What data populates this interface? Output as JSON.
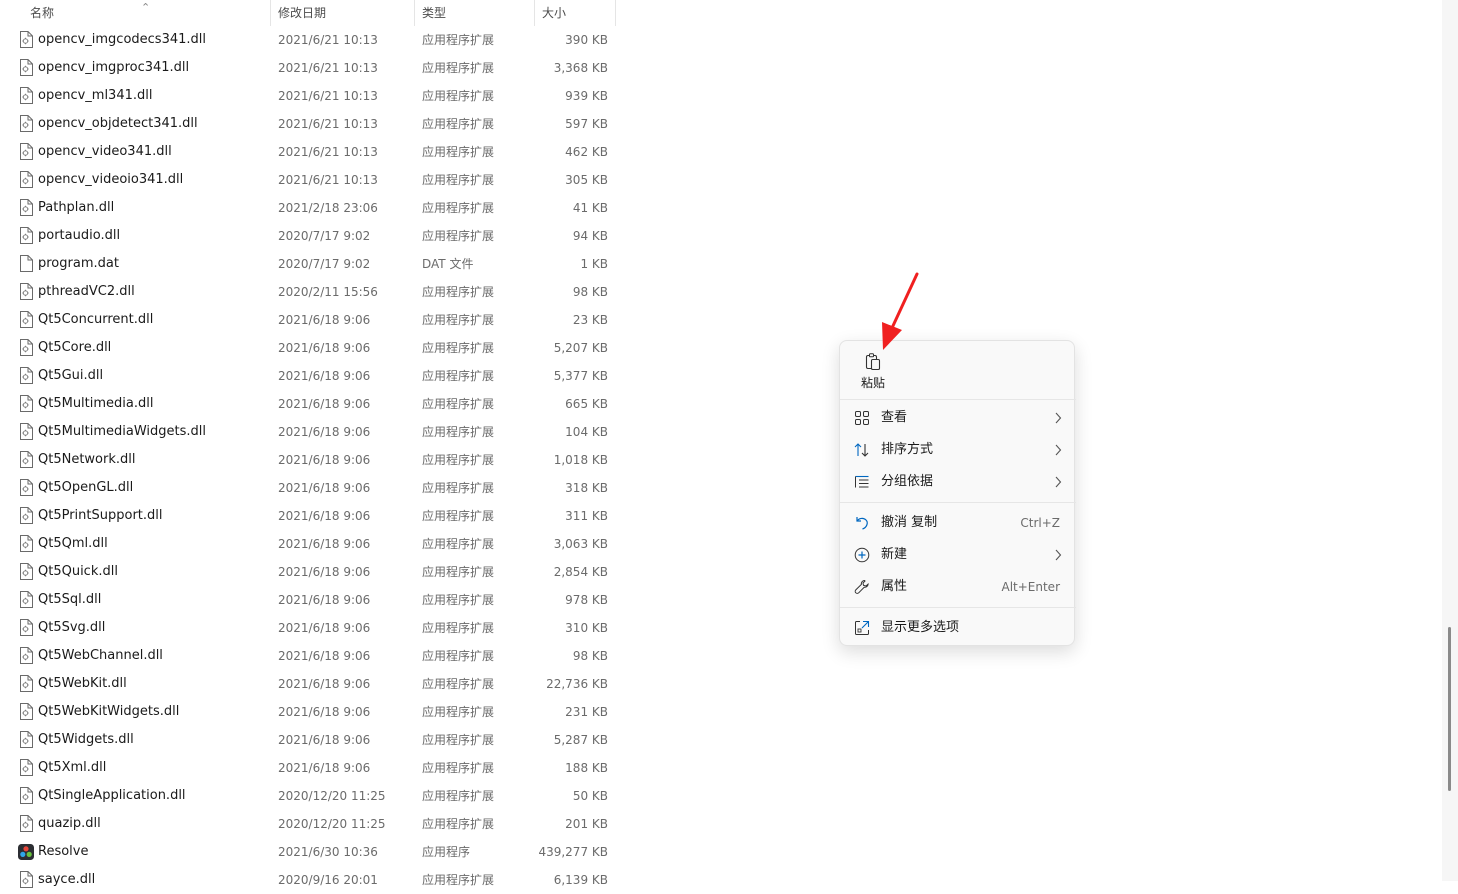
{
  "columns": {
    "name": "名称",
    "date": "修改日期",
    "type": "类型",
    "size": "大小"
  },
  "files": [
    {
      "name": "opencv_imgcodecs341.dll",
      "date": "2021/6/21 10:13",
      "type": "应用程序扩展",
      "size": "390 KB",
      "icon": "dll-file-icon"
    },
    {
      "name": "opencv_imgproc341.dll",
      "date": "2021/6/21 10:13",
      "type": "应用程序扩展",
      "size": "3,368 KB",
      "icon": "dll-file-icon"
    },
    {
      "name": "opencv_ml341.dll",
      "date": "2021/6/21 10:13",
      "type": "应用程序扩展",
      "size": "939 KB",
      "icon": "dll-file-icon"
    },
    {
      "name": "opencv_objdetect341.dll",
      "date": "2021/6/21 10:13",
      "type": "应用程序扩展",
      "size": "597 KB",
      "icon": "dll-file-icon"
    },
    {
      "name": "opencv_video341.dll",
      "date": "2021/6/21 10:13",
      "type": "应用程序扩展",
      "size": "462 KB",
      "icon": "dll-file-icon"
    },
    {
      "name": "opencv_videoio341.dll",
      "date": "2021/6/21 10:13",
      "type": "应用程序扩展",
      "size": "305 KB",
      "icon": "dll-file-icon"
    },
    {
      "name": "Pathplan.dll",
      "date": "2021/2/18 23:06",
      "type": "应用程序扩展",
      "size": "41 KB",
      "icon": "dll-file-icon"
    },
    {
      "name": "portaudio.dll",
      "date": "2020/7/17 9:02",
      "type": "应用程序扩展",
      "size": "94 KB",
      "icon": "dll-file-icon"
    },
    {
      "name": "program.dat",
      "date": "2020/7/17 9:02",
      "type": "DAT 文件",
      "size": "1 KB",
      "icon": "blank-file-icon"
    },
    {
      "name": "pthreadVC2.dll",
      "date": "2020/2/11 15:56",
      "type": "应用程序扩展",
      "size": "98 KB",
      "icon": "dll-file-icon"
    },
    {
      "name": "Qt5Concurrent.dll",
      "date": "2021/6/18 9:06",
      "type": "应用程序扩展",
      "size": "23 KB",
      "icon": "dll-file-icon"
    },
    {
      "name": "Qt5Core.dll",
      "date": "2021/6/18 9:06",
      "type": "应用程序扩展",
      "size": "5,207 KB",
      "icon": "dll-file-icon"
    },
    {
      "name": "Qt5Gui.dll",
      "date": "2021/6/18 9:06",
      "type": "应用程序扩展",
      "size": "5,377 KB",
      "icon": "dll-file-icon"
    },
    {
      "name": "Qt5Multimedia.dll",
      "date": "2021/6/18 9:06",
      "type": "应用程序扩展",
      "size": "665 KB",
      "icon": "dll-file-icon"
    },
    {
      "name": "Qt5MultimediaWidgets.dll",
      "date": "2021/6/18 9:06",
      "type": "应用程序扩展",
      "size": "104 KB",
      "icon": "dll-file-icon"
    },
    {
      "name": "Qt5Network.dll",
      "date": "2021/6/18 9:06",
      "type": "应用程序扩展",
      "size": "1,018 KB",
      "icon": "dll-file-icon"
    },
    {
      "name": "Qt5OpenGL.dll",
      "date": "2021/6/18 9:06",
      "type": "应用程序扩展",
      "size": "318 KB",
      "icon": "dll-file-icon"
    },
    {
      "name": "Qt5PrintSupport.dll",
      "date": "2021/6/18 9:06",
      "type": "应用程序扩展",
      "size": "311 KB",
      "icon": "dll-file-icon"
    },
    {
      "name": "Qt5Qml.dll",
      "date": "2021/6/18 9:06",
      "type": "应用程序扩展",
      "size": "3,063 KB",
      "icon": "dll-file-icon"
    },
    {
      "name": "Qt5Quick.dll",
      "date": "2021/6/18 9:06",
      "type": "应用程序扩展",
      "size": "2,854 KB",
      "icon": "dll-file-icon"
    },
    {
      "name": "Qt5Sql.dll",
      "date": "2021/6/18 9:06",
      "type": "应用程序扩展",
      "size": "978 KB",
      "icon": "dll-file-icon"
    },
    {
      "name": "Qt5Svg.dll",
      "date": "2021/6/18 9:06",
      "type": "应用程序扩展",
      "size": "310 KB",
      "icon": "dll-file-icon"
    },
    {
      "name": "Qt5WebChannel.dll",
      "date": "2021/6/18 9:06",
      "type": "应用程序扩展",
      "size": "98 KB",
      "icon": "dll-file-icon"
    },
    {
      "name": "Qt5WebKit.dll",
      "date": "2021/6/18 9:06",
      "type": "应用程序扩展",
      "size": "22,736 KB",
      "icon": "dll-file-icon"
    },
    {
      "name": "Qt5WebKitWidgets.dll",
      "date": "2021/6/18 9:06",
      "type": "应用程序扩展",
      "size": "231 KB",
      "icon": "dll-file-icon"
    },
    {
      "name": "Qt5Widgets.dll",
      "date": "2021/6/18 9:06",
      "type": "应用程序扩展",
      "size": "5,287 KB",
      "icon": "dll-file-icon"
    },
    {
      "name": "Qt5Xml.dll",
      "date": "2021/6/18 9:06",
      "type": "应用程序扩展",
      "size": "188 KB",
      "icon": "dll-file-icon"
    },
    {
      "name": "QtSingleApplication.dll",
      "date": "2020/12/20 11:25",
      "type": "应用程序扩展",
      "size": "50 KB",
      "icon": "dll-file-icon"
    },
    {
      "name": "quazip.dll",
      "date": "2020/12/20 11:25",
      "type": "应用程序扩展",
      "size": "201 KB",
      "icon": "dll-file-icon"
    },
    {
      "name": "Resolve",
      "date": "2021/6/30 10:36",
      "type": "应用程序",
      "size": "439,277 KB",
      "icon": "resolve-app-icon"
    },
    {
      "name": "sayce.dll",
      "date": "2020/9/16 20:01",
      "type": "应用程序扩展",
      "size": "6,139 KB",
      "icon": "dll-file-icon"
    }
  ],
  "context_menu": {
    "paste_label": "粘贴",
    "items": [
      {
        "label": "查看",
        "icon": "grid-view-icon",
        "submenu": true
      },
      {
        "label": "排序方式",
        "icon": "sort-icon",
        "submenu": true
      },
      {
        "label": "分组依据",
        "icon": "group-by-icon",
        "submenu": true
      },
      {
        "label": "撤消 复制",
        "icon": "undo-icon",
        "shortcut": "Ctrl+Z"
      },
      {
        "label": "新建",
        "icon": "new-plus-icon",
        "submenu": true
      },
      {
        "label": "属性",
        "icon": "wrench-icon",
        "shortcut": "Alt+Enter"
      },
      {
        "label": "显示更多选项",
        "icon": "show-more-icon"
      }
    ]
  },
  "colors": {
    "accent": "#0067c0",
    "annotation_arrow": "#f02020"
  }
}
